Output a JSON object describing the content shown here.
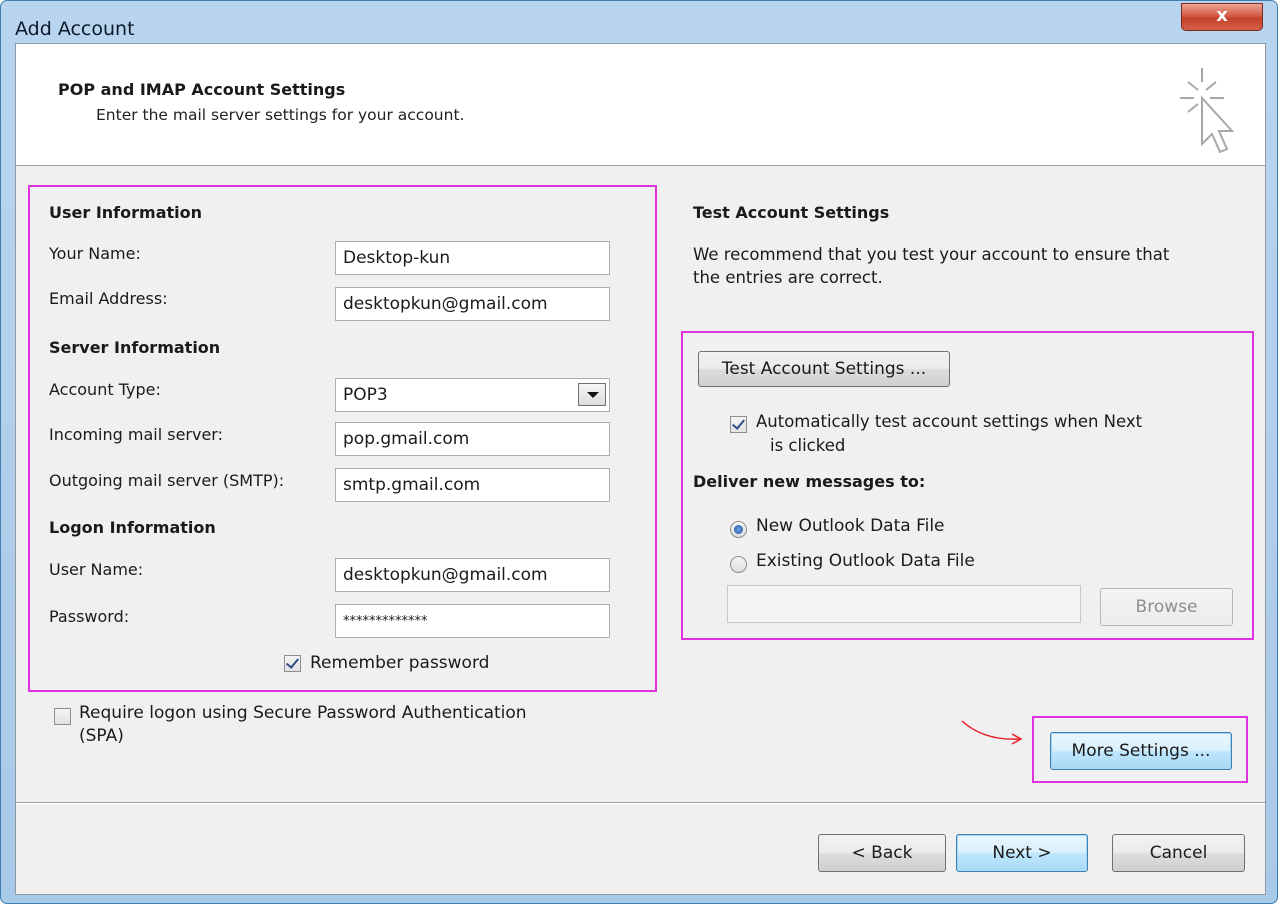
{
  "window": {
    "title": "Add Account",
    "close_label": "x"
  },
  "header": {
    "title": "POP and IMAP Account Settings",
    "subtitle": "Enter the mail server settings for your account."
  },
  "user_info": {
    "section_title": "User Information",
    "name_label": "Your Name:",
    "name_value": "Desktop-kun",
    "email_label": "Email Address:",
    "email_value": "desktopkun@gmail.com"
  },
  "server_info": {
    "section_title": "Server Information",
    "account_type_label": "Account Type:",
    "account_type_value": "POP3",
    "incoming_label": "Incoming mail server:",
    "incoming_value": "pop.gmail.com",
    "outgoing_label": "Outgoing mail server (SMTP):",
    "outgoing_value": "smtp.gmail.com"
  },
  "logon_info": {
    "section_title": "Logon Information",
    "username_label": "User Name:",
    "username_value": "desktopkun@gmail.com",
    "password_label": "Password:",
    "password_value": "*************",
    "remember_label": "Remember password",
    "remember_checked": true
  },
  "spa": {
    "label_line1": "Require logon using Secure Password Authentication",
    "label_line2": "(SPA)",
    "checked": false
  },
  "test": {
    "section_title": "Test Account Settings",
    "description_line1": "We recommend that you test your account to ensure that",
    "description_line2": "the entries are correct.",
    "button_label": "Test Account Settings ...",
    "auto_test_line1": "Automatically test account settings when Next",
    "auto_test_line2": "is clicked",
    "auto_test_checked": true
  },
  "deliver": {
    "title": "Deliver new messages to:",
    "option_new": "New Outlook Data File",
    "option_existing": "Existing Outlook Data File",
    "selected": "New Outlook Data File",
    "path_value": "",
    "browse_label": "Browse"
  },
  "more_settings_label": "More Settings ...",
  "footer": {
    "back_label": "< Back",
    "next_label": "Next >",
    "cancel_label": "Cancel"
  },
  "colors": {
    "highlight": "#e033e0",
    "arrow": "#e8202a",
    "accent": "#3c7fb1"
  }
}
